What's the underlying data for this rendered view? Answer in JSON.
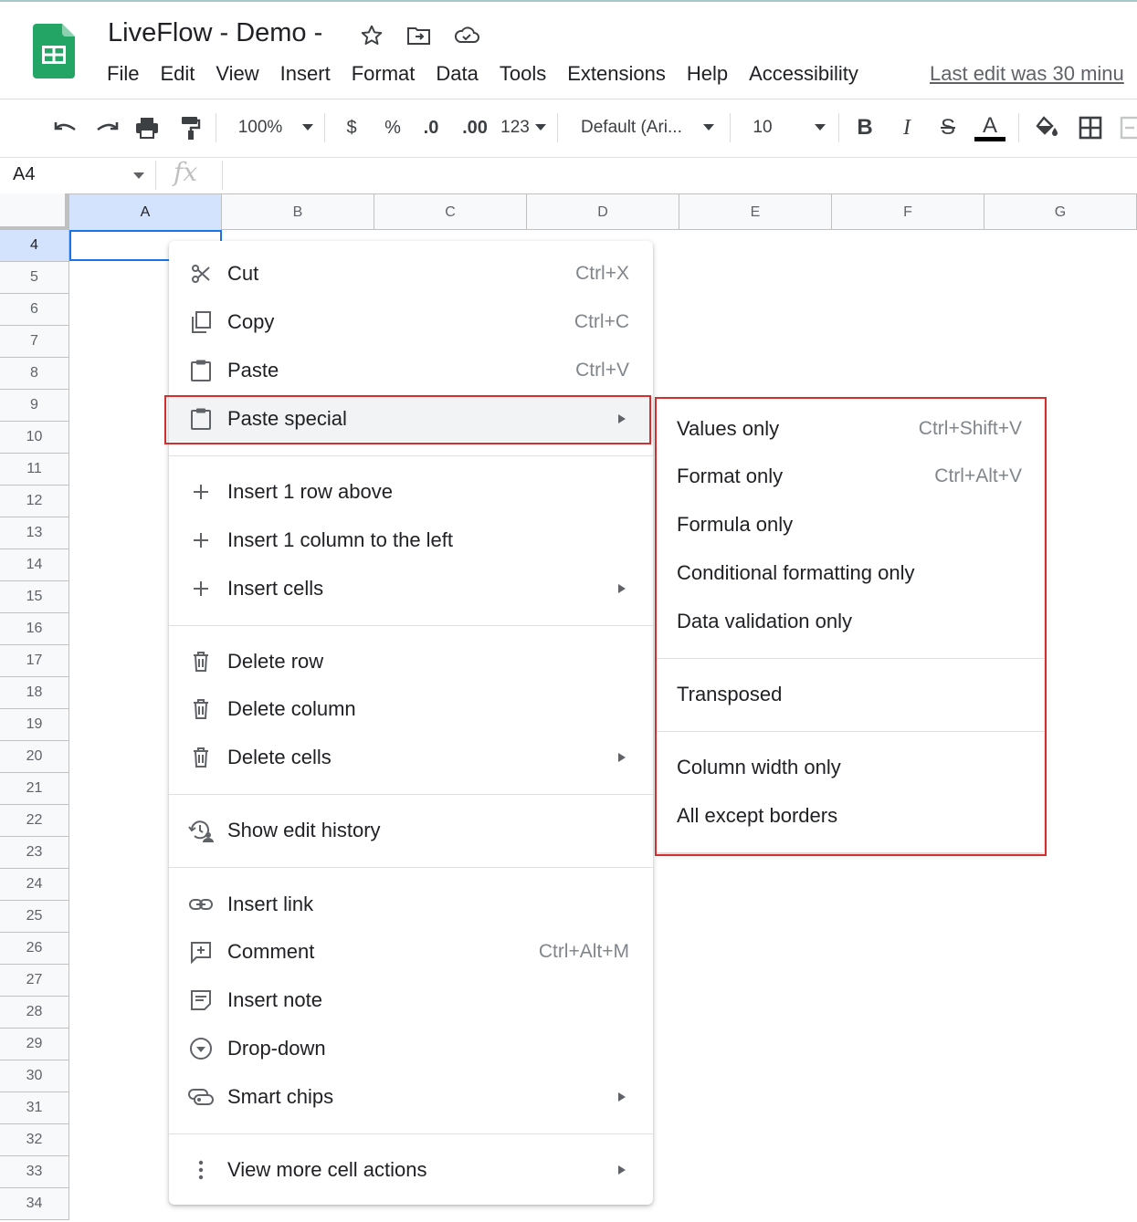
{
  "document": {
    "title": "LiveFlow - Demo -",
    "last_edit": "Last edit was 30 minu"
  },
  "menubar": [
    "File",
    "Edit",
    "View",
    "Insert",
    "Format",
    "Data",
    "Tools",
    "Extensions",
    "Help",
    "Accessibility"
  ],
  "toolbar": {
    "zoom": "100%",
    "currency": "$",
    "percent": "%",
    "decrease_decimal": ".0",
    "increase_decimal": ".00",
    "more_formats": "123",
    "font": "Default (Ari...",
    "font_size": "10",
    "bold": "B",
    "italic": "I",
    "strike": "S",
    "text_color": "A"
  },
  "formula_bar": {
    "cell_ref": "A4",
    "fx": "fx"
  },
  "grid": {
    "columns": [
      "A",
      "B",
      "C",
      "D",
      "E",
      "F",
      "G"
    ],
    "rows": [
      "4",
      "5",
      "6",
      "7",
      "8",
      "9",
      "10",
      "11",
      "12",
      "13",
      "14",
      "15",
      "16",
      "17",
      "18",
      "19",
      "20",
      "21",
      "22",
      "23",
      "24",
      "25",
      "26",
      "27",
      "28",
      "29",
      "30",
      "31",
      "32",
      "33",
      "34"
    ],
    "selected_cell": "A4"
  },
  "context_menu": {
    "cut": {
      "label": "Cut",
      "shortcut": "Ctrl+X"
    },
    "copy": {
      "label": "Copy",
      "shortcut": "Ctrl+C"
    },
    "paste": {
      "label": "Paste",
      "shortcut": "Ctrl+V"
    },
    "paste_special": {
      "label": "Paste special"
    },
    "insert_row": {
      "label": "Insert 1 row above"
    },
    "insert_col": {
      "label": "Insert 1 column to the left"
    },
    "insert_cells": {
      "label": "Insert cells"
    },
    "delete_row": {
      "label": "Delete row"
    },
    "delete_col": {
      "label": "Delete column"
    },
    "delete_cells": {
      "label": "Delete cells"
    },
    "edit_history": {
      "label": "Show edit history"
    },
    "insert_link": {
      "label": "Insert link"
    },
    "comment": {
      "label": "Comment",
      "shortcut": "Ctrl+Alt+M"
    },
    "insert_note": {
      "label": "Insert note"
    },
    "dropdown": {
      "label": "Drop-down"
    },
    "smart_chips": {
      "label": "Smart chips"
    },
    "more_actions": {
      "label": "View more cell actions"
    }
  },
  "paste_special_menu": {
    "values_only": {
      "label": "Values only",
      "shortcut": "Ctrl+Shift+V"
    },
    "format_only": {
      "label": "Format only",
      "shortcut": "Ctrl+Alt+V"
    },
    "formula_only": {
      "label": "Formula only"
    },
    "cond_format_only": {
      "label": "Conditional formatting only"
    },
    "data_validation_only": {
      "label": "Data validation only"
    },
    "transposed": {
      "label": "Transposed"
    },
    "column_width_only": {
      "label": "Column width only"
    },
    "all_except_borders": {
      "label": "All except borders"
    }
  },
  "colors": {
    "highlight_box": "#d32f2f",
    "selection": "#1a73e8",
    "sheets_green": "#0f9d58"
  }
}
